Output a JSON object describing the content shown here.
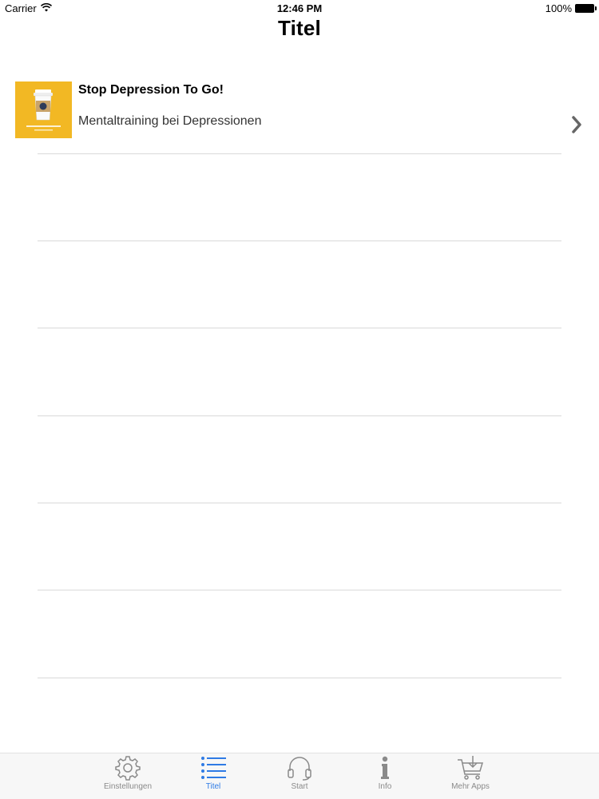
{
  "status_bar": {
    "carrier": "Carrier",
    "time": "12:46 PM",
    "battery": "100%"
  },
  "nav": {
    "title": "Titel"
  },
  "list": {
    "items": [
      {
        "title": "Stop Depression To Go!",
        "subtitle": "Mentaltraining bei Depressionen",
        "thumbnail_icon": "coffee-cup-icon",
        "thumbnail_bg": "#f2b824"
      }
    ]
  },
  "tab_bar": {
    "accent_color": "#2f7be5",
    "inactive_color": "#8a8a8a",
    "tabs": [
      {
        "label": "Einstellungen",
        "icon": "gear-icon",
        "active": false
      },
      {
        "label": "Titel",
        "icon": "list-icon",
        "active": true
      },
      {
        "label": "Start",
        "icon": "headphones-icon",
        "active": false
      },
      {
        "label": "Info",
        "icon": "info-icon",
        "active": false
      },
      {
        "label": "Mehr Apps",
        "icon": "shopping-cart-icon",
        "active": false
      }
    ]
  }
}
